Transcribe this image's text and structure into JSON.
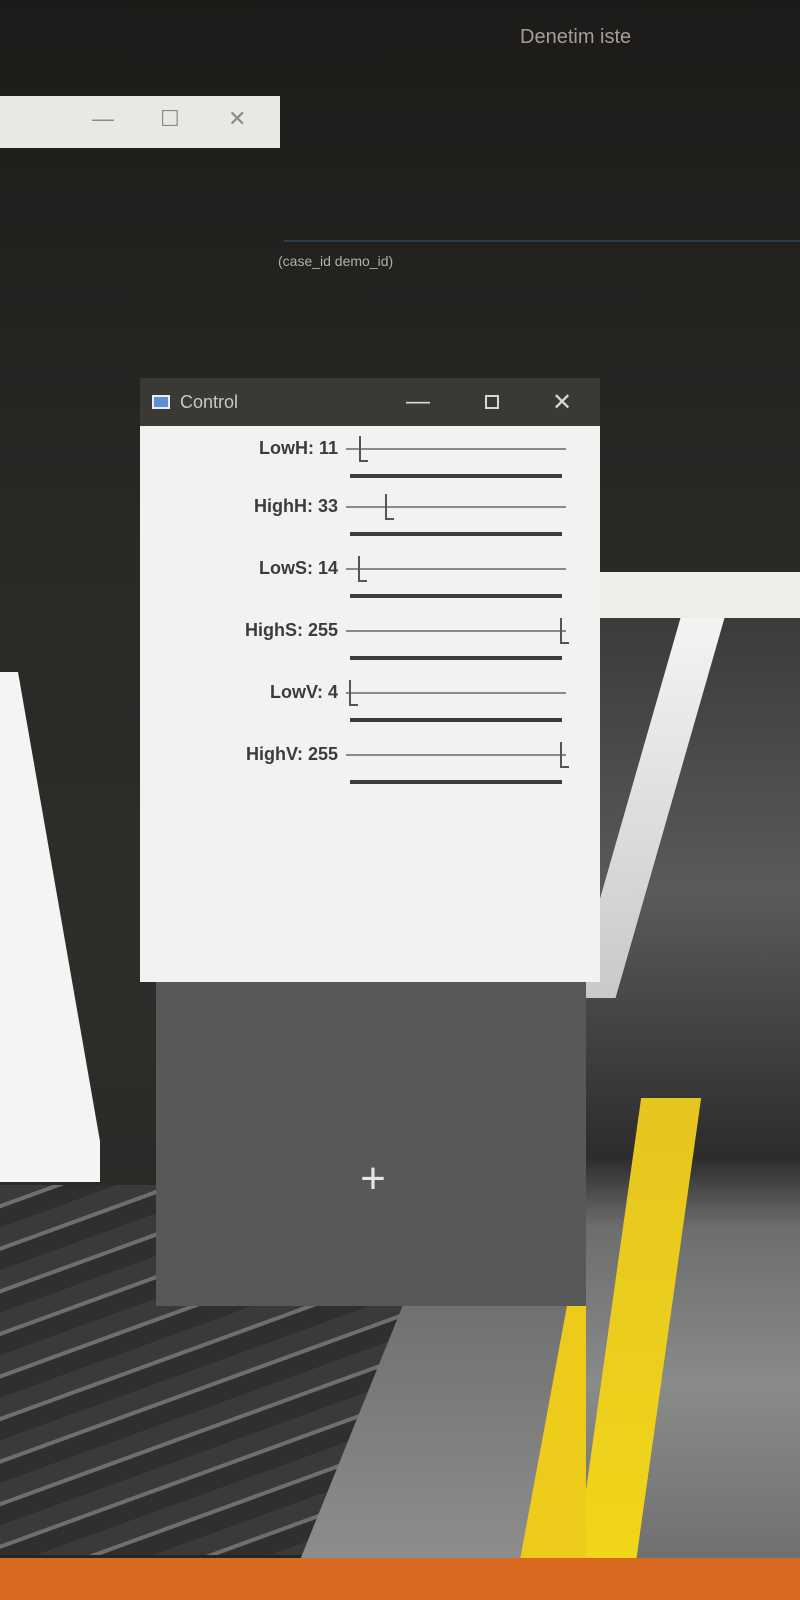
{
  "background": {
    "top_right_text": "Denetim iste",
    "code_text": "(case_id demo_id)",
    "window_controls": {
      "minimize": "—",
      "maximize": "☐",
      "close": "✕"
    }
  },
  "window": {
    "title": "Control",
    "icon": "app-window-icon",
    "controls": {
      "minimize": "—",
      "close": "✕"
    }
  },
  "trackbars": [
    {
      "name": "LowH",
      "label": "LowH: 11",
      "value": 11,
      "max": 179
    },
    {
      "name": "HighH",
      "label": "HighH: 33",
      "value": 33,
      "max": 179
    },
    {
      "name": "LowS",
      "label": "LowS: 14",
      "value": 14,
      "max": 255
    },
    {
      "name": "HighS",
      "label": "HighS: 255",
      "value": 255,
      "max": 255
    },
    {
      "name": "LowV",
      "label": "LowV: 4",
      "value": 4,
      "max": 255
    },
    {
      "name": "HighV",
      "label": "HighV: 255",
      "value": 255,
      "max": 255
    }
  ],
  "image_area": {
    "icon": "plus-icon",
    "glyph": "+"
  },
  "colors": {
    "titlebar": "#3a3935",
    "panel": "#f2f2f0",
    "image_area": "#585858",
    "platform_line": "#eccb1b",
    "taskbar": "#d9691f"
  }
}
